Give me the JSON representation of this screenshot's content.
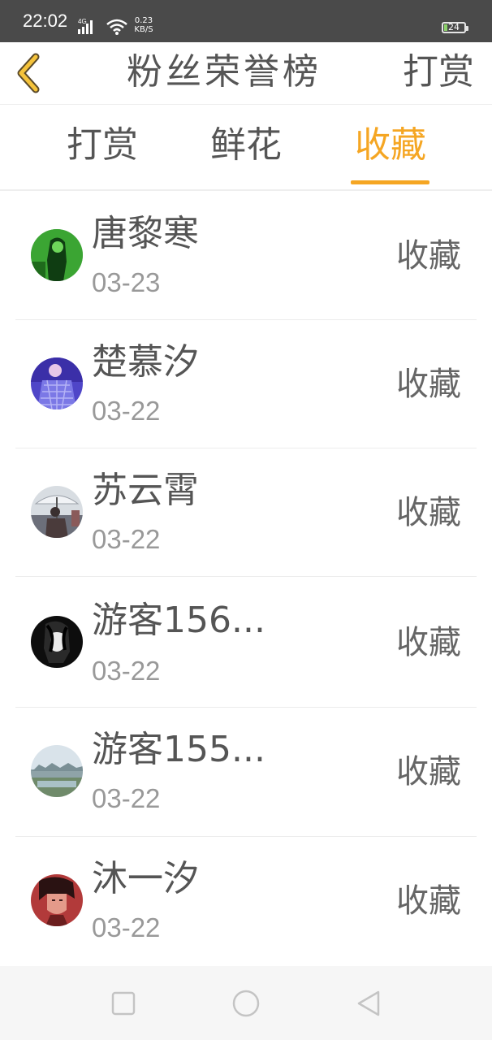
{
  "status_bar": {
    "time": "22:02",
    "network": "4G",
    "speed_value": "0.23",
    "speed_unit": "KB/S",
    "battery": "24"
  },
  "header": {
    "title": "粉丝荣誉榜",
    "action_label": "打赏",
    "back_icon": "chevron-left-icon"
  },
  "tabs": [
    {
      "label": "打赏",
      "active": false
    },
    {
      "label": "鲜花",
      "active": false
    },
    {
      "label": "收藏",
      "active": true
    }
  ],
  "accent_color": "#f5a623",
  "list": [
    {
      "name": "唐黎寒",
      "date": "03-23",
      "tag": "收藏",
      "avatar_icon": "avatar-green-photo"
    },
    {
      "name": "楚慕汐",
      "date": "03-22",
      "tag": "收藏",
      "avatar_icon": "avatar-purple-photo"
    },
    {
      "name": "苏云霄",
      "date": "03-22",
      "tag": "收藏",
      "avatar_icon": "avatar-umbrella-photo"
    },
    {
      "name": "游客156...",
      "date": "03-22",
      "tag": "收藏",
      "avatar_icon": "avatar-dark-portrait"
    },
    {
      "name": "游客155...",
      "date": "03-22",
      "tag": "收藏",
      "avatar_icon": "avatar-landscape-photo"
    },
    {
      "name": "沐一汐",
      "date": "03-22",
      "tag": "收藏",
      "avatar_icon": "avatar-red-portrait"
    }
  ],
  "nav_bar": {
    "recent_icon": "square-icon",
    "home_icon": "circle-icon",
    "back_icon": "triangle-back-icon"
  }
}
